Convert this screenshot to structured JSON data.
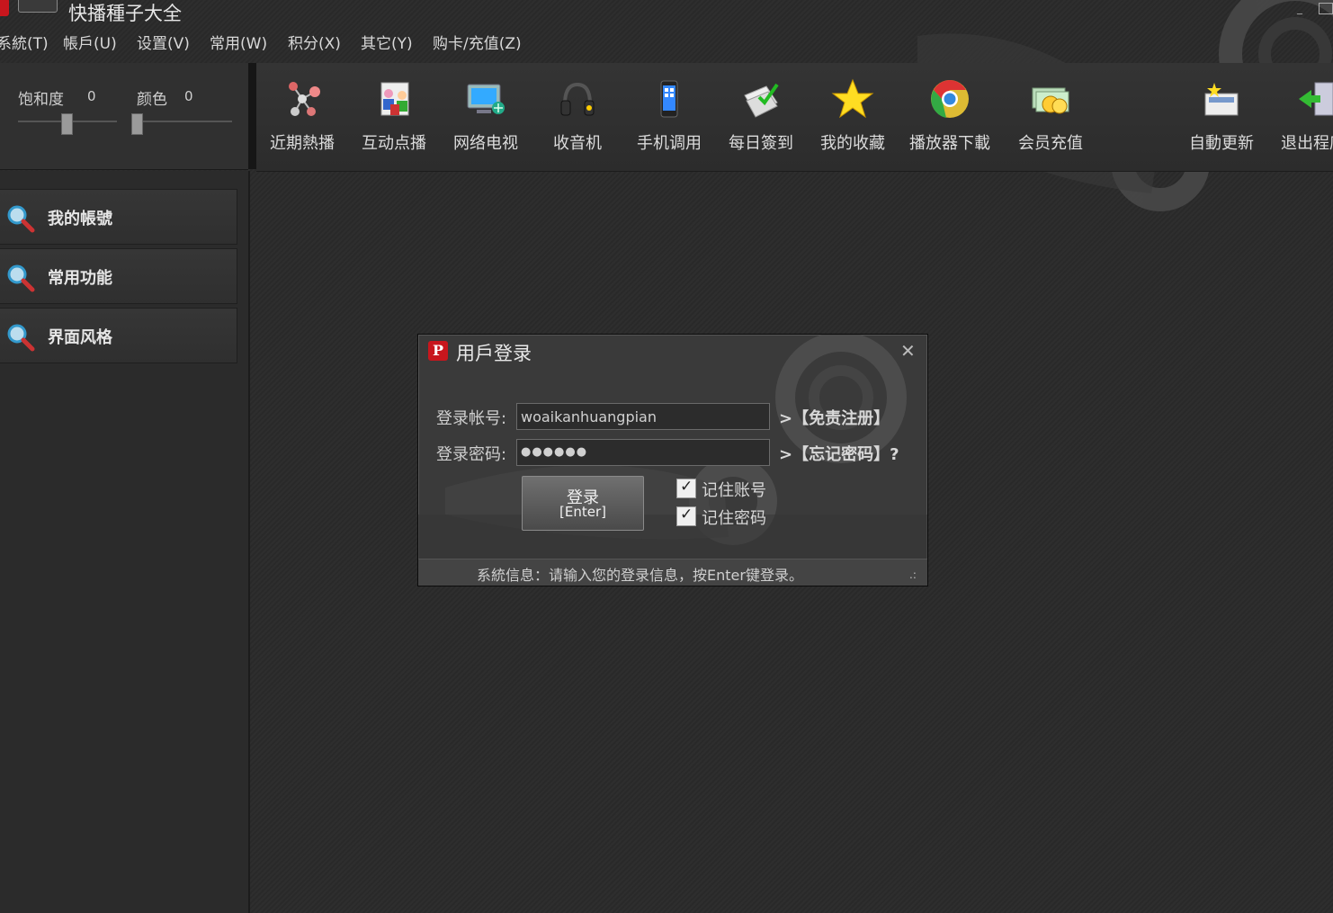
{
  "app": {
    "title": "快播種子大全"
  },
  "menu": [
    "系統(T)",
    "帳戶(U)",
    "设置(V)",
    "常用(W)",
    "积分(X)",
    "其它(Y)",
    "购卡/充值(Z)"
  ],
  "adjust": {
    "saturation_label": "饱和度",
    "saturation_value": "0",
    "color_label": "颜色",
    "color_value": "0"
  },
  "toolbar": [
    {
      "label": "近期熱播",
      "icon": "molecule-icon"
    },
    {
      "label": "互动点播",
      "icon": "users-icon"
    },
    {
      "label": "网络电视",
      "icon": "tv-icon"
    },
    {
      "label": "收音机",
      "icon": "headphones-icon"
    },
    {
      "label": "手机调用",
      "icon": "phone-icon"
    },
    {
      "label": "每日簽到",
      "icon": "checkin-icon"
    },
    {
      "label": "我的收藏",
      "icon": "star-icon"
    },
    {
      "label": "播放器下載",
      "icon": "chrome-icon"
    },
    {
      "label": "会员充值",
      "icon": "coins-icon"
    },
    {
      "label": "自動更新",
      "icon": "update-icon"
    },
    {
      "label": "退出程序",
      "icon": "exit-icon"
    }
  ],
  "sidebar": [
    {
      "label": "我的帳號",
      "icon": "search-icon"
    },
    {
      "label": "常用功能",
      "icon": "search-icon"
    },
    {
      "label": "界面风格",
      "icon": "search-icon"
    }
  ],
  "login": {
    "title": "用戶登录",
    "account_label": "登录帐号:",
    "account_value": "woaikanhuangpian",
    "password_label": "登录密码:",
    "password_value": "●●●●●●",
    "register_link": ">【免责注册】",
    "forgot_link": ">【忘记密码】?",
    "login_button_line1": "登录",
    "login_button_line2": "[Enter]",
    "remember_account": "记住账号",
    "remember_password": "记住密码",
    "status": "系統信息：请输入您的登录信息，按Enter键登录。"
  },
  "colors": {
    "brand_red": "#c8161d",
    "background": "#2a2a2a"
  }
}
